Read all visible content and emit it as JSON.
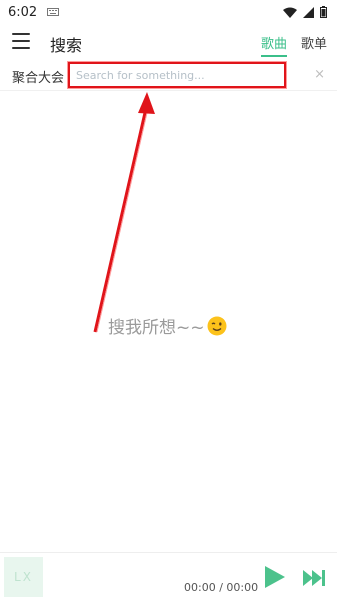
{
  "status_bar": {
    "time": "6:02",
    "battery_icon": "battery-icon",
    "wifi_icon": "wifi-icon",
    "signal_icon": "signal-icon",
    "keyboard_icon": "keyboard-icon"
  },
  "header": {
    "menu_icon": "menu-icon",
    "title": "搜索",
    "tabs": [
      {
        "label": "歌曲",
        "active": true
      },
      {
        "label": "歌单",
        "active": false
      }
    ]
  },
  "search": {
    "source_label": "聚合大会",
    "placeholder": "Search for something...",
    "value": "",
    "clear_label": "×"
  },
  "empty_state": {
    "text": "搜我所想~~",
    "emoji": "winking-face"
  },
  "player": {
    "logo_text": "LX",
    "time_text": "00:00 / 00:00",
    "play_icon": "play-icon",
    "next_icon": "skip-next-icon"
  },
  "colors": {
    "accent": "#3bbf8a",
    "annotation_red": "#e0141a",
    "empty_text": "#9a9a9a"
  }
}
